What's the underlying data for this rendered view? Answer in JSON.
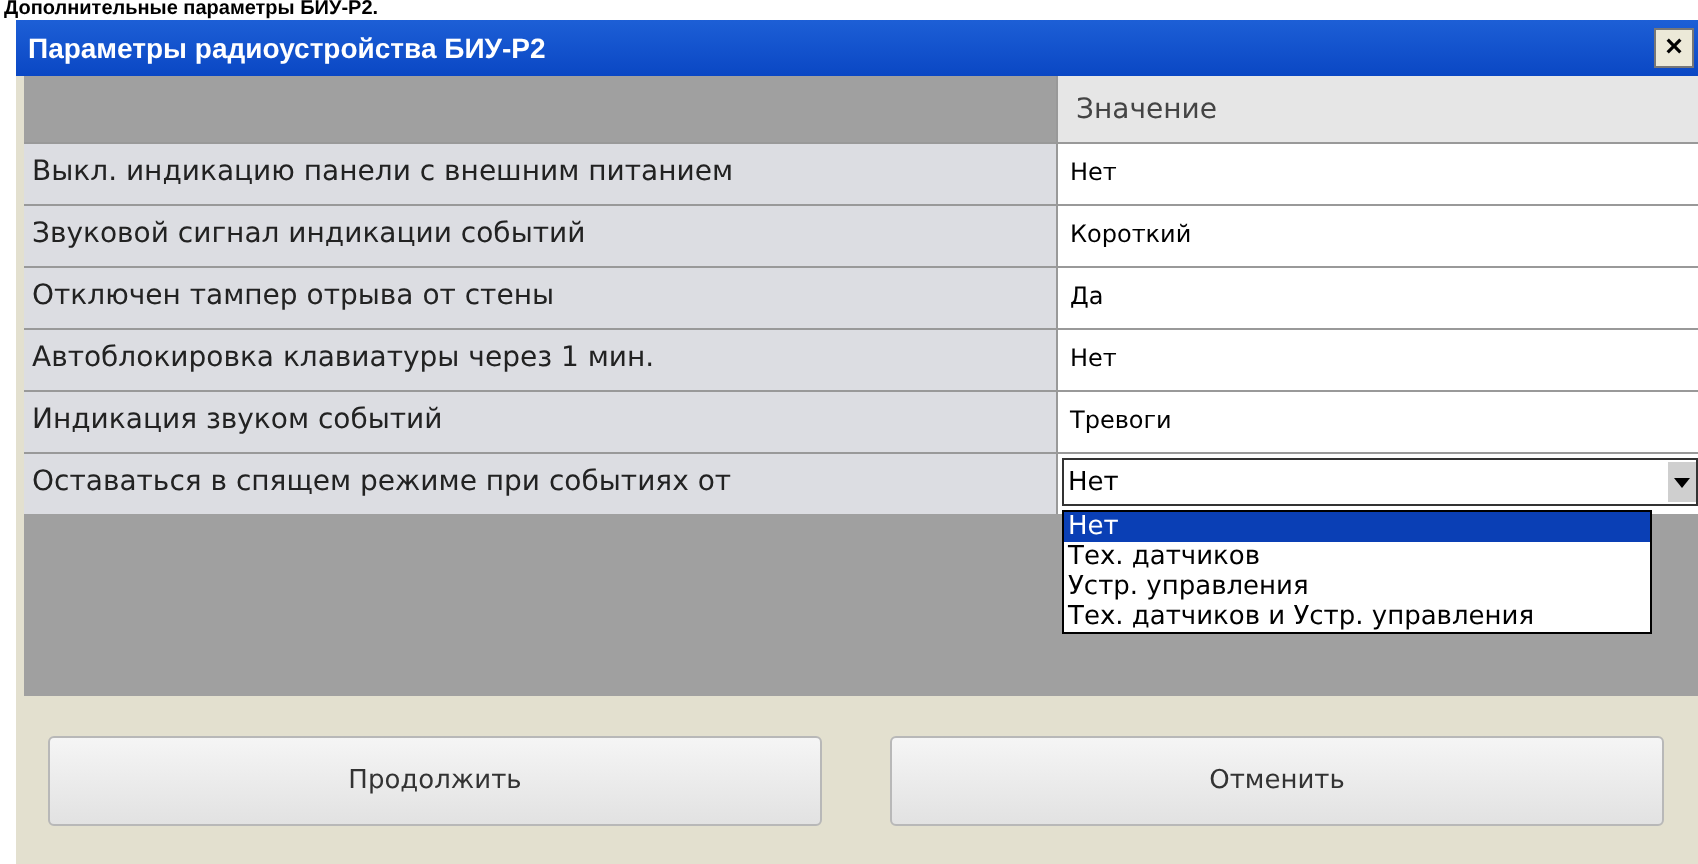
{
  "heading": "Дополнительные параметры БИУ-Р2.",
  "window": {
    "title": "Параметры радиоустройства БИУ-Р2",
    "close": "×"
  },
  "table": {
    "columns": [
      "Значение"
    ],
    "rows": [
      {
        "kind": "text",
        "name": "Выкл. индикацию панели с внешним питанием",
        "value": "Нет"
      },
      {
        "kind": "text",
        "name": "Звуковой сигнал индикации событий",
        "value": "Короткий"
      },
      {
        "kind": "text",
        "name": "Отключен тампер отрыва от стены",
        "value": "Да"
      },
      {
        "kind": "text",
        "name": "Автоблокировка клавиатуры через 1 мин.",
        "value": "Нет"
      },
      {
        "kind": "text",
        "name": "Индикация звуком событий",
        "value": "Тревоги"
      },
      {
        "kind": "combo",
        "name": "Оставаться в спящем режиме при событиях от",
        "value": "Нет",
        "expanded": true,
        "options": [
          {
            "label": "Нет",
            "selected": true
          },
          {
            "label": "Тех. датчиков",
            "selected": false
          },
          {
            "label": "Устр. управления",
            "selected": false
          },
          {
            "label": "Тех. датчиков и Устр. управления",
            "selected": false
          }
        ]
      }
    ]
  },
  "buttons": [
    "Продолжить",
    "Отменить"
  ]
}
